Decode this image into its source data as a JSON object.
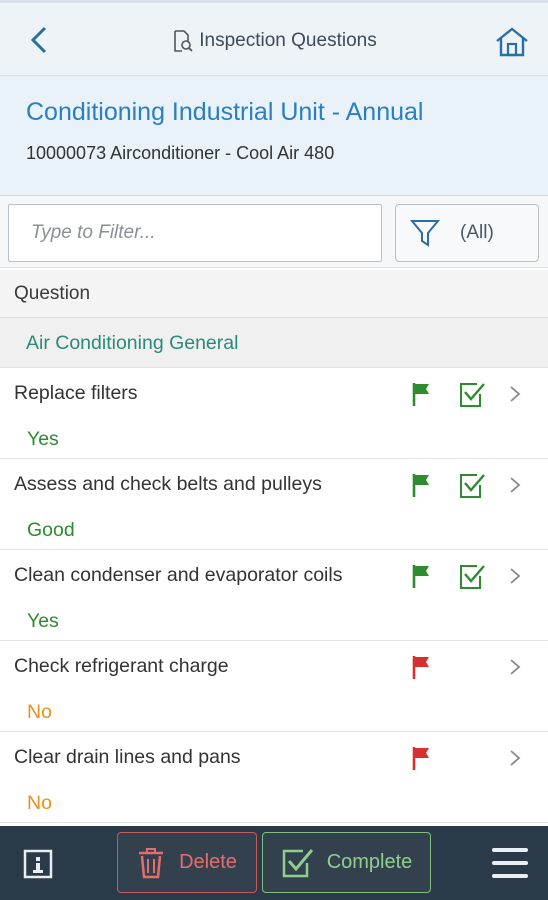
{
  "header": {
    "title": "Inspection Questions",
    "back_icon": "chevron-left-icon",
    "title_icon": "document-search-icon",
    "home_icon": "home-icon"
  },
  "object": {
    "title": "Conditioning Industrial Unit - Annual",
    "subtitle": "10000073 Airconditioner - Cool Air 480"
  },
  "filter": {
    "placeholder": "Type to Filter...",
    "value": "",
    "scope_label": "(All)",
    "scope_icon": "filter-funnel-icon"
  },
  "table": {
    "column_header": "Question",
    "group_label": "Air Conditioning General",
    "rows": [
      {
        "question": "Replace filters",
        "answer": "Yes",
        "answer_color": "#2e8b2e",
        "flag": "green",
        "completed": true
      },
      {
        "question": "Assess and check belts and pulleys",
        "answer": "Good",
        "answer_color": "#2e8b2e",
        "flag": "green",
        "completed": true
      },
      {
        "question": "Clean condenser and evaporator coils",
        "answer": "Yes",
        "answer_color": "#2e8b2e",
        "flag": "green",
        "completed": true
      },
      {
        "question": "Check refrigerant charge",
        "answer": "No",
        "answer_color": "#e8901a",
        "flag": "red",
        "completed": false
      },
      {
        "question": "Clear drain lines and pans",
        "answer": "No",
        "answer_color": "#e8901a",
        "flag": "red",
        "completed": false
      }
    ]
  },
  "footer": {
    "info_icon": "info-icon",
    "delete_label": "Delete",
    "delete_icon": "trash-icon",
    "complete_label": "Complete",
    "complete_icon": "checkbox-icon",
    "menu_icon": "hamburger-menu-icon"
  },
  "colors": {
    "accent_blue": "#2a7fbf",
    "group_teal": "#2a8a7a",
    "flag_green": "#2e8b2e",
    "flag_red": "#d63030",
    "footer_bg": "#2b3a48"
  }
}
